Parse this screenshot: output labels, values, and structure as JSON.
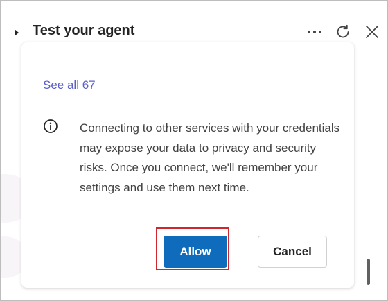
{
  "header": {
    "title": "Test your agent",
    "expand_icon": "caret-right-icon",
    "more_icon": "more-horizontal-icon",
    "refresh_icon": "refresh-icon",
    "close_icon": "close-icon"
  },
  "card": {
    "see_all_link": "See all 67",
    "info_icon": "info-icon",
    "warning_text": "Connecting to other services with your credentials may expose your data to privacy and security risks. Once you connect, we'll remember your settings and use them next time.",
    "allow_label": "Allow",
    "cancel_label": "Cancel"
  },
  "colors": {
    "accent": "#0f6cbd",
    "link": "#5b5fc7",
    "highlight": "#d0262d"
  }
}
